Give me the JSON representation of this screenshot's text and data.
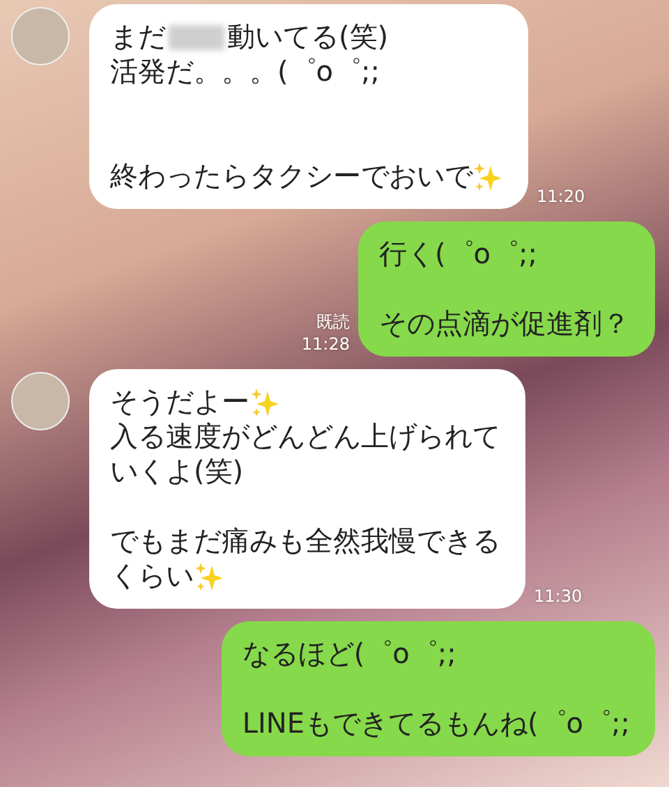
{
  "messages": [
    {
      "kind": "received",
      "avatar": true,
      "time": "11:20",
      "lines": [
        {
          "kind": "text",
          "text": "まだ",
          "redacted": true,
          "after": "動いてる(笑)"
        },
        {
          "kind": "text",
          "text": "活発だ。。。(゜o゜;;"
        },
        {
          "kind": "blank"
        },
        {
          "kind": "blank"
        },
        {
          "kind": "text",
          "text": "終わったらタクシーでおいで",
          "sparkle": true
        }
      ]
    },
    {
      "kind": "sent",
      "read": "既読",
      "time": "11:28",
      "lines": [
        {
          "kind": "text",
          "text": "行く(゜o゜;;"
        },
        {
          "kind": "blank"
        },
        {
          "kind": "text",
          "text": "その点滴が促進剤？"
        }
      ]
    },
    {
      "kind": "received",
      "avatar": true,
      "time": "11:30",
      "lines": [
        {
          "kind": "text",
          "text": "そうだよー",
          "sparkle": true
        },
        {
          "kind": "text",
          "text": "入る速度がどんどん上げられて"
        },
        {
          "kind": "text",
          "text": "いくよ(笑)"
        },
        {
          "kind": "blank"
        },
        {
          "kind": "text",
          "text": "でもまだ痛みも全然我慢できる"
        },
        {
          "kind": "text",
          "text": "くらい",
          "sparkle": true
        }
      ]
    },
    {
      "kind": "sent",
      "lines": [
        {
          "kind": "text",
          "text": "なるほど(゜o゜;;"
        },
        {
          "kind": "blank"
        },
        {
          "kind": "text",
          "text": "LINEもできてるもんね(゜o゜;;"
        }
      ]
    }
  ]
}
